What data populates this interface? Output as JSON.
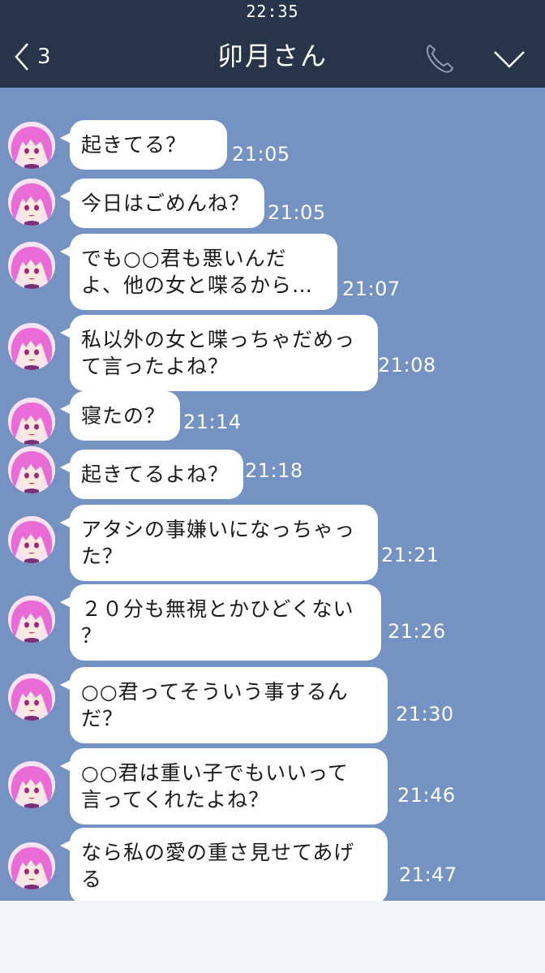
{
  "status": {
    "time": "22:35"
  },
  "header": {
    "back_count": "3",
    "title": "卯月さん",
    "icons": [
      "back-chevron-icon",
      "phone-icon",
      "chevron-down-icon"
    ]
  },
  "messages": [
    {
      "text": "起きてる？",
      "time": "21:05"
    },
    {
      "text": "今日はごめんね？",
      "time": "21:05"
    },
    {
      "text": "でも○○君も悪いんだ\nよ、他の女と喋るから…",
      "time": "21:07"
    },
    {
      "text": "私以外の女と喋っちゃだめっ\nて言ったよね？",
      "time": "21:08"
    },
    {
      "text": "寝たの？",
      "time": "21:14"
    },
    {
      "text": "起きてるよね？",
      "time": "21:18"
    },
    {
      "text": "アタシの事嫌いになっちゃっ\nた？",
      "time": "21:21"
    },
    {
      "text": "２０分も無視とかひどくない\n？",
      "time": "21:26"
    },
    {
      "text": "○○君ってそういう事するん\nだ？",
      "time": "21:30"
    },
    {
      "text": "○○君は重い子でもいいって\n言ってくれたよね？",
      "time": "21:46"
    },
    {
      "text": "なら私の愛の重さ見せてあげ\nる",
      "time": "21:47"
    }
  ],
  "colors": {
    "header_bg": "#273449",
    "chat_bg": "#7493c2",
    "bubble_bg": "#ffffff",
    "avatar_hair": "#e86bd6"
  }
}
